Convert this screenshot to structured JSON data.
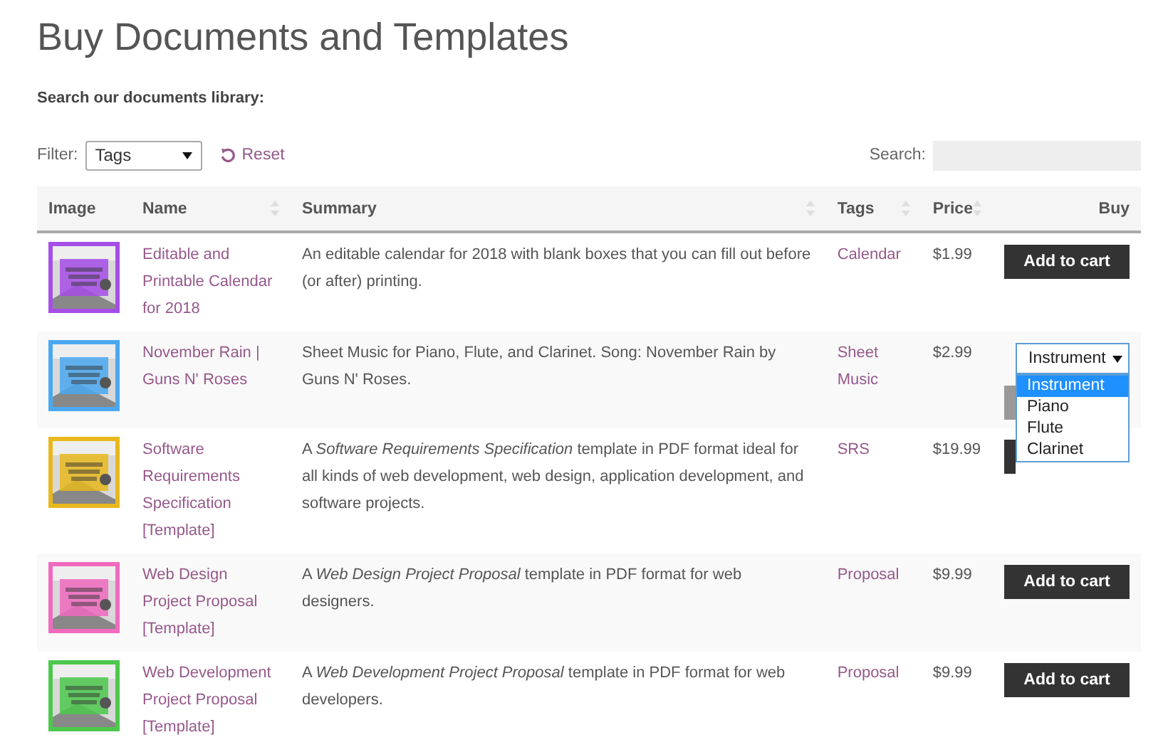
{
  "title": "Buy Documents and Templates",
  "subtitle": "Search our documents library:",
  "filter": {
    "label": "Filter:",
    "value": "Tags",
    "reset": "Reset"
  },
  "search": {
    "label": "Search:"
  },
  "columns": [
    {
      "label": "Image",
      "sortable": false
    },
    {
      "label": "Name",
      "sortable": true
    },
    {
      "label": "Summary",
      "sortable": true
    },
    {
      "label": "Tags",
      "sortable": true
    },
    {
      "label": "Price",
      "sortable": true
    },
    {
      "label": "Buy",
      "sortable": false
    }
  ],
  "rows": [
    {
      "name": "Editable and Printable Calendar for 2018",
      "summary": "An editable calendar for 2018 with blank boxes that you can fill out before (or after) printing.",
      "tag": "Calendar",
      "price": "$1.99",
      "buy": {
        "kind": "button",
        "label": "Add to cart"
      }
    },
    {
      "name": "November Rain | Guns N' Roses",
      "summary": "Sheet Music for Piano, Flute, and Clarinet. Song: November Rain by Guns N' Roses.",
      "tag": "Sheet Music",
      "price": "$2.99",
      "buy": {
        "kind": "select",
        "value": "Instrument",
        "expanded": true,
        "options": [
          {
            "label": "Instrument",
            "selected": true
          },
          {
            "label": "Piano",
            "selected": false
          },
          {
            "label": "Flute",
            "selected": false
          },
          {
            "label": "Clarinet",
            "selected": false
          }
        ]
      }
    },
    {
      "name": "Software Requirements Specification [Template]",
      "summary": "A *Software Requirements Specification* template in PDF format ideal for all kinds of web development, web design, application development, and software projects.",
      "tag": "SRS",
      "price": "$19.99",
      "buy": {
        "kind": "covered"
      }
    },
    {
      "name": "Web Design Project Proposal [Template]",
      "summary": "A *Web Design Project Proposal* template in PDF format for web designers.",
      "tag": "Proposal",
      "price": "$9.99",
      "buy": {
        "kind": "button",
        "label": "Add to cart"
      }
    },
    {
      "name": "Web Development Project Proposal [Template]",
      "summary": "A *Web Development Project Proposal* template in PDF format for web developers.",
      "tag": "Proposal",
      "price": "$9.99",
      "buy": {
        "kind": "button",
        "label": "Add to cart"
      }
    }
  ]
}
